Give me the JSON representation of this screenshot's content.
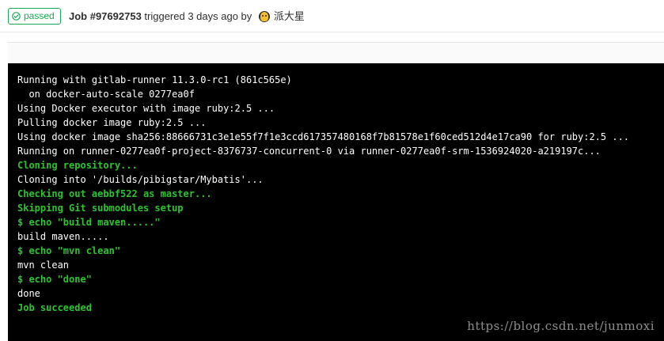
{
  "header": {
    "status": "passed",
    "job_id": "Job #97692753",
    "triggered_text": " triggered 3 days ago by ",
    "user_name": "派大星"
  },
  "colors": {
    "success": "#1aaa55",
    "log_green": "#2bc530",
    "terminal_bg": "#000000"
  },
  "icons": {
    "status": "check-circle-icon",
    "avatar": "user-avatar"
  },
  "log": [
    {
      "text": "Running with gitlab-runner 11.3.0-rc1 (861c565e)",
      "style": "normal"
    },
    {
      "text": "  on docker-auto-scale 0277ea0f",
      "style": "normal"
    },
    {
      "text": "Using Docker executor with image ruby:2.5 ...",
      "style": "normal"
    },
    {
      "text": "Pulling docker image ruby:2.5 ...",
      "style": "normal"
    },
    {
      "text": "Using docker image sha256:88666731c3e1e55f7f1e3ccd617357480168f7b81578e1f60ced512d4e17ca90 for ruby:2.5 ...",
      "style": "normal"
    },
    {
      "text": "Running on runner-0277ea0f-project-8376737-concurrent-0 via runner-0277ea0f-srm-1536924020-a219197c...",
      "style": "normal"
    },
    {
      "text": "Cloning repository...",
      "style": "green"
    },
    {
      "text": "Cloning into '/builds/pibigstar/Mybatis'...",
      "style": "normal"
    },
    {
      "text": "Checking out aebbf522 as master...",
      "style": "green"
    },
    {
      "text": "Skipping Git submodules setup",
      "style": "green"
    },
    {
      "text": "$ echo \"build maven.....\"",
      "style": "green"
    },
    {
      "text": "build maven.....",
      "style": "normal"
    },
    {
      "text": "$ echo \"mvn clean\"",
      "style": "green"
    },
    {
      "text": "mvn clean",
      "style": "normal"
    },
    {
      "text": "$ echo \"done\"",
      "style": "green"
    },
    {
      "text": "done",
      "style": "normal"
    },
    {
      "text": "Job succeeded",
      "style": "green"
    }
  ],
  "watermark": "https://blog.csdn.net/junmoxi"
}
